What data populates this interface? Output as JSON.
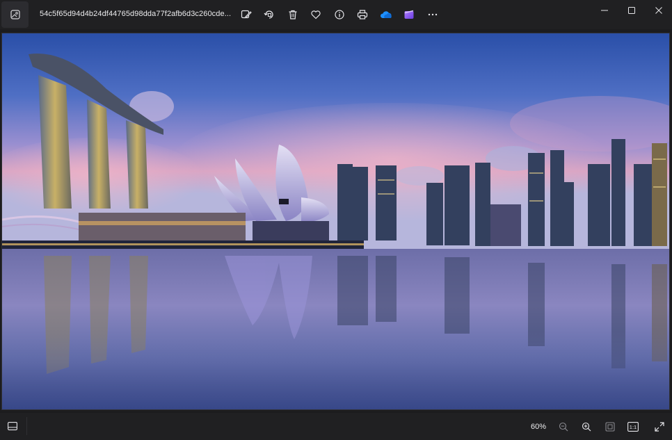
{
  "window": {
    "file_name": "54c5f65d94d4b24df44765d98dda77f2afb6d3c260cde...",
    "controls": {
      "minimize": "minimize",
      "maximize": "maximize",
      "close": "close"
    }
  },
  "toolbar": {
    "items": [
      {
        "name": "edit-image-icon",
        "label": "Edit image"
      },
      {
        "name": "rotate-icon",
        "label": "Rotate"
      },
      {
        "name": "delete-icon",
        "label": "Delete"
      },
      {
        "name": "favorite-heart-icon",
        "label": "Favorite"
      },
      {
        "name": "file-info-icon",
        "label": "File info"
      },
      {
        "name": "print-icon",
        "label": "Print"
      },
      {
        "name": "onedrive-cloud-icon",
        "label": "OneDrive"
      },
      {
        "name": "clipchamp-icon",
        "label": "Clipchamp"
      },
      {
        "name": "more-options-icon",
        "label": "See more"
      }
    ]
  },
  "image": {
    "subject": "night skyline photo"
  },
  "bottombar": {
    "zoom_level": "60%",
    "actual_size_label": "1:1"
  },
  "colors": {
    "chrome_bg": "#202022",
    "canvas_bg": "#1c1c1e",
    "onedrive_blue": "#1e90ff",
    "clipchamp_purple": "#8a5cf5"
  }
}
